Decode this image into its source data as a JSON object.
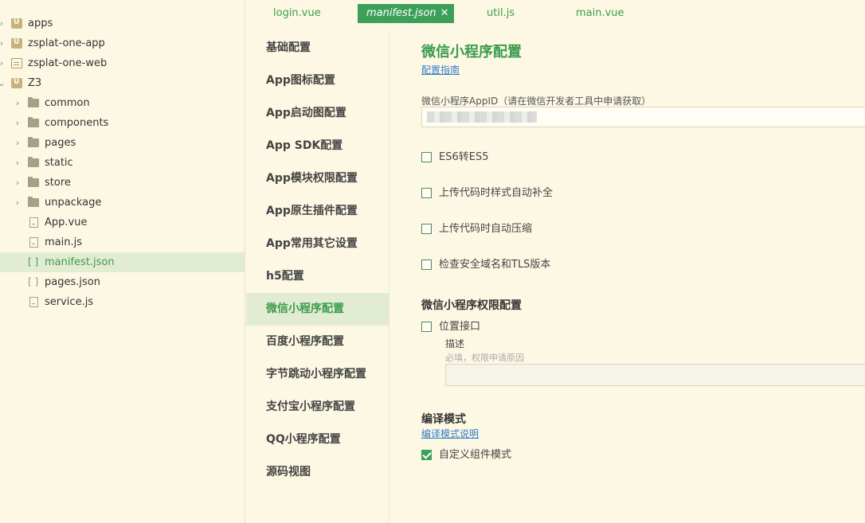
{
  "tree": [
    {
      "label": "apps",
      "level": 0,
      "arrow": "›",
      "icon": "project-icon"
    },
    {
      "label": "zsplat-one-app",
      "level": 0,
      "arrow": "›",
      "icon": "project-icon"
    },
    {
      "label": "zsplat-one-web",
      "level": 0,
      "arrow": "›",
      "icon": "web-project-icon"
    },
    {
      "label": "Z3",
      "level": 0,
      "arrow": "⌄",
      "icon": "project-icon"
    },
    {
      "label": "common",
      "level": 1,
      "arrow": "›",
      "icon": "folder-icon"
    },
    {
      "label": "components",
      "level": 1,
      "arrow": "›",
      "icon": "folder-icon"
    },
    {
      "label": "pages",
      "level": 1,
      "arrow": "›",
      "icon": "folder-icon"
    },
    {
      "label": "static",
      "level": 1,
      "arrow": "›",
      "icon": "folder-icon"
    },
    {
      "label": "store",
      "level": 1,
      "arrow": "›",
      "icon": "folder-icon"
    },
    {
      "label": "unpackage",
      "level": 1,
      "arrow": "›",
      "icon": "folder-icon"
    },
    {
      "label": "App.vue",
      "level": 1,
      "arrow": "",
      "icon": "vue-file-icon"
    },
    {
      "label": "main.js",
      "level": 1,
      "arrow": "",
      "icon": "js-file-icon"
    },
    {
      "label": "manifest.json",
      "level": 1,
      "arrow": "",
      "icon": "json-file-icon",
      "selected": true
    },
    {
      "label": "pages.json",
      "level": 1,
      "arrow": "",
      "icon": "json-file-icon"
    },
    {
      "label": "service.js",
      "level": 1,
      "arrow": "",
      "icon": "js-file-icon"
    }
  ],
  "tabs": [
    {
      "label": "login.vue"
    },
    {
      "label": "manifest.json",
      "active": true,
      "close": "✕"
    },
    {
      "label": "util.js"
    },
    {
      "label": "main.vue"
    }
  ],
  "settings_nav": [
    {
      "label": "基础配置"
    },
    {
      "label": "App图标配置"
    },
    {
      "label": "App启动图配置"
    },
    {
      "label": "App SDK配置"
    },
    {
      "label": "App模块权限配置"
    },
    {
      "label": "App原生插件配置"
    },
    {
      "label": "App常用其它设置"
    },
    {
      "label": "h5配置"
    },
    {
      "label": "微信小程序配置",
      "active": true
    },
    {
      "label": "百度小程序配置"
    },
    {
      "label": "字节跳动小程序配置"
    },
    {
      "label": "支付宝小程序配置"
    },
    {
      "label": "QQ小程序配置"
    },
    {
      "label": "源码视图"
    }
  ],
  "content": {
    "title": "微信小程序配置",
    "guide_link": "配置指南",
    "appid_label": "微信小程序AppID（请在微信开发者工具中申请获取）",
    "options": [
      {
        "label": "ES6转ES5",
        "checked": false
      },
      {
        "label": "上传代码时样式自动补全",
        "checked": false
      },
      {
        "label": "上传代码时自动压缩",
        "checked": false
      },
      {
        "label": "检查安全域名和TLS版本",
        "checked": false
      }
    ],
    "permission_title": "微信小程序权限配置",
    "location_label": "位置接口",
    "location_checked": false,
    "desc_label": "描述",
    "desc_placeholder": "必填，权限申请原因",
    "compile_title": "编译模式",
    "compile_link": "编译模式说明",
    "custom_component_label": "自定义组件模式",
    "custom_component_checked": true
  },
  "colors": {
    "accent": "#3da05a",
    "link": "#2f7cc7",
    "background": "#fdf8e4",
    "selected_bg": "#e2ecd2"
  }
}
